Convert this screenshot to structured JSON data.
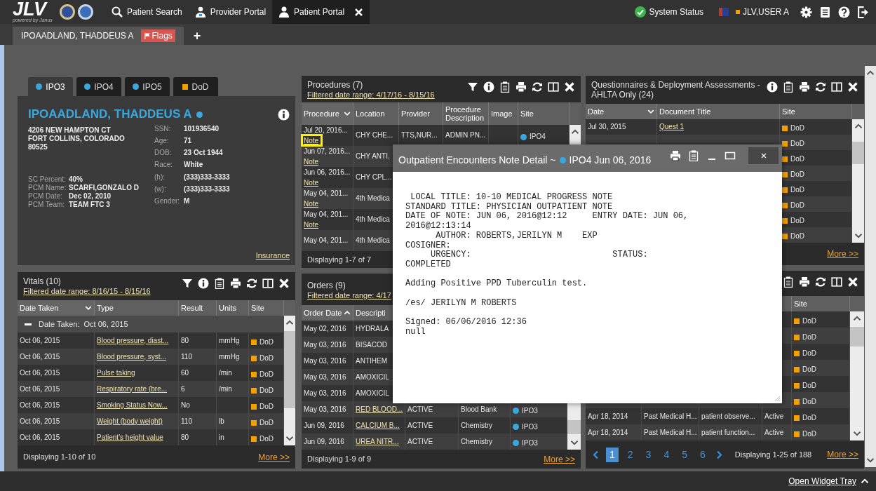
{
  "header": {
    "logo": "JLV",
    "tagline": "powered by Janus",
    "nav": [
      {
        "label": "Patient Search",
        "selected": false,
        "closable": false
      },
      {
        "label": "Provider Portal",
        "selected": false,
        "closable": false
      },
      {
        "label": "Patient Portal",
        "selected": true,
        "closable": true
      }
    ],
    "system_status": "System Status",
    "user": "JLV,USER A"
  },
  "patient_tabs": {
    "tabs": [
      {
        "label": "IPOAADLAND, THADDEUS A",
        "flag": "Flags",
        "selected": true
      }
    ],
    "add": "+"
  },
  "patient_card": {
    "sites": [
      {
        "label": "IPO3",
        "kind": "dot",
        "color": "#3aa8e0",
        "selected": true
      },
      {
        "label": "IPO4",
        "kind": "dot",
        "color": "#3aa8e0",
        "selected": false
      },
      {
        "label": "IPO5",
        "kind": "dot",
        "color": "#3aa8e0",
        "selected": false
      },
      {
        "label": "DoD",
        "kind": "square",
        "color": "#f5a000",
        "selected": false
      }
    ],
    "name": "IPOAADLAND, THADDEUS A",
    "address": [
      "4206 NEW HAMPTON CT",
      "FORT COLLINS, COLORADO",
      "80525"
    ],
    "care_fields": [
      {
        "label": "SC Percent:",
        "value": "40%"
      },
      {
        "label": "PCM Name:",
        "value": "SCARFI,GONZALO D"
      },
      {
        "label": "PCM Date:",
        "value": "Dec 02, 2010"
      },
      {
        "label": "PCM Team:",
        "value": "TEAM FTC 3"
      }
    ],
    "demographics": [
      {
        "label": "SSN:",
        "value": "101936540"
      },
      {
        "label": "Age:",
        "value": "71"
      },
      {
        "label": "DOB:",
        "value": "23 Oct 1944"
      },
      {
        "label": "Race:",
        "value": "White"
      },
      {
        "label": "(h):",
        "value": "(333)333-3333"
      },
      {
        "label": "(w):",
        "value": "(333)333-3333"
      },
      {
        "label": "Gender:",
        "value": "M"
      }
    ],
    "insurance_link": "Insurance"
  },
  "procedures": {
    "title": "Procedures (7)",
    "filter": "Filtered date range: 4/17/16 - 8/15/16",
    "columns": [
      {
        "label": "Procedure",
        "sorted": true,
        "ascending": false
      },
      {
        "label": "Location",
        "sorted": false
      },
      {
        "label": "Provider",
        "sorted": false
      },
      {
        "label": "Procedure Description",
        "sorted": false
      },
      {
        "label": "Image",
        "sorted": false
      },
      {
        "label": "Site",
        "sorted": false
      }
    ],
    "rows": [
      [
        {
          "text": "Jul 20, 2016...",
          "note": "Note"
        },
        "CHY CHE...",
        "TTS,NUR...",
        "ADMIN PN...",
        null,
        {
          "site": "IPO4",
          "kind": "dot",
          "color": "#3aa8e0"
        }
      ],
      [
        {
          "text": "Jun 07, 2016...",
          "note": "Note"
        },
        "CHY ANTI."
      ],
      [
        {
          "text": "Jun 06, 2016...",
          "note": "Note"
        },
        "CHY CPL..."
      ],
      [
        {
          "text": "May 04, 201...",
          "note": "Note"
        },
        "4th Medica"
      ],
      [
        {
          "text": "May 04, 201...",
          "note": "Note"
        },
        "4th Medica"
      ],
      [
        {
          "text": "May 04, 201..."
        },
        "4th Medica"
      ]
    ],
    "footer": "Displaying 1-7 of 7"
  },
  "questionnaires": {
    "title": "Questionnaires & Deployment Assessments - AHLTA Only (24)",
    "columns": [
      {
        "label": "Date",
        "sorted": true,
        "ascending": false
      },
      {
        "label": "Document Title",
        "sorted": false
      },
      {
        "label": "Site",
        "sorted": false
      }
    ],
    "rows": [
      [
        "Jul 30, 2015",
        {
          "link": "Quest 1"
        },
        {
          "site": "DoD",
          "kind": "square",
          "color": "#f5a000"
        }
      ],
      [
        null,
        null,
        {
          "site": "DoD",
          "kind": "square",
          "color": "#f5a000"
        }
      ],
      [
        null,
        null,
        {
          "site": "DoD",
          "kind": "square",
          "color": "#f5a000"
        }
      ],
      [
        null,
        null,
        {
          "site": "DoD",
          "kind": "square",
          "color": "#f5a000"
        }
      ],
      [
        null,
        null,
        {
          "site": "DoD",
          "kind": "square",
          "color": "#f5a000"
        }
      ],
      [
        null,
        null,
        {
          "site": "DoD",
          "kind": "square",
          "color": "#f5a000"
        }
      ],
      [
        null,
        null,
        {
          "site": "DoD",
          "kind": "square",
          "color": "#f5a000"
        }
      ],
      [
        null,
        null,
        {
          "site": "DoD",
          "kind": "square",
          "color": "#f5a000"
        }
      ]
    ],
    "more": "More >>"
  },
  "vitals": {
    "title": "Vitals (10)",
    "filter": "Filtered date range: 8/16/15 - 8/15/16",
    "columns": [
      {
        "label": "Date Taken",
        "sorted": true,
        "ascending": false
      },
      {
        "label": "Type",
        "sorted": false
      },
      {
        "label": "Result",
        "sorted": false
      },
      {
        "label": "Units",
        "sorted": false
      },
      {
        "label": "Site",
        "sorted": false
      }
    ],
    "group": {
      "label": "Date Taken:",
      "value": "Oct 06, 2015",
      "expanded": true
    },
    "rows": [
      [
        "Oct 06, 2015",
        {
          "link": "Blood pressure, diast..."
        },
        "80",
        "mmHg",
        {
          "site": "DoD",
          "kind": "square",
          "color": "#f5a000"
        }
      ],
      [
        "Oct 06, 2015",
        {
          "link": "Blood pressure, syst..."
        },
        "110",
        "mmHg",
        {
          "site": "DoD",
          "kind": "square",
          "color": "#f5a000"
        }
      ],
      [
        "Oct 06, 2015",
        {
          "link": "Pulse taking"
        },
        "60",
        "/min",
        {
          "site": "DoD",
          "kind": "square",
          "color": "#f5a000"
        }
      ],
      [
        "Oct 06, 2015",
        {
          "link": "Respiratory rate (bre..."
        },
        "6",
        "/min",
        {
          "site": "DoD",
          "kind": "square",
          "color": "#f5a000"
        }
      ],
      [
        "Oct 06, 2015",
        {
          "link": "Smoking Status Now..."
        },
        "No",
        null,
        {
          "site": "DoD",
          "kind": "square",
          "color": "#f5a000"
        }
      ],
      [
        "Oct 06, 2015",
        {
          "link": "Weight (body weight)"
        },
        "110",
        "lb",
        {
          "site": "DoD",
          "kind": "square",
          "color": "#f5a000"
        }
      ],
      [
        "Oct 06, 2015",
        {
          "link": "Patient's height value"
        },
        "80",
        "in",
        {
          "site": "DoD",
          "kind": "square",
          "color": "#f5a000"
        }
      ]
    ],
    "footer": "Displaying 1-10 of 10",
    "more": "More >>"
  },
  "orders": {
    "title": "Orders (9)",
    "filter": "Filtered date range: 4/17",
    "columns": [
      {
        "label": "Order Date",
        "sorted": true,
        "ascending": true
      },
      {
        "label": "Descripti"
      },
      null,
      null,
      null
    ],
    "rows": [
      [
        "May 02, 2016",
        "HYDRALA"
      ],
      [
        "May 03, 2016",
        "BISACOD"
      ],
      [
        "May 03, 2016",
        "ANTIHEM"
      ],
      [
        "May 03, 2016",
        "AMOXICIL"
      ],
      [
        "May 03, 2016",
        "AMOXICIL"
      ],
      [
        "May 03, 2016",
        {
          "link": "RED BLOOD..."
        },
        "ACTIVE",
        "Blood Bank",
        {
          "site": "IPO3",
          "kind": "dot",
          "color": "#3aa8e0"
        }
      ],
      [
        "Jun 09, 2016",
        {
          "link": "CALCIUM B..."
        },
        "ACTIVE",
        "Chemistry",
        {
          "site": "IPO3",
          "kind": "dot",
          "color": "#3aa8e0"
        }
      ],
      [
        "Jun 09, 2016",
        {
          "link": "UREA NITR..."
        },
        "ACTIVE",
        "Chemistry",
        {
          "site": "IPO3",
          "kind": "dot",
          "color": "#3aa8e0"
        }
      ]
    ],
    "footer": "Displaying 1-9 of 9",
    "more": "More >>"
  },
  "lower_right_widget": {
    "columns": [
      null,
      null,
      null,
      null,
      {
        "label": "Site",
        "sorted": false
      }
    ],
    "rows": [
      [
        null,
        null,
        null,
        null,
        {
          "site": "DoD",
          "kind": "square",
          "color": "#f5a000"
        }
      ],
      [
        null,
        null,
        null,
        null,
        {
          "site": "DoD",
          "kind": "square",
          "color": "#f5a000"
        }
      ],
      [
        null,
        null,
        null,
        null,
        {
          "site": "DoD",
          "kind": "square",
          "color": "#f5a000"
        }
      ],
      [
        null,
        null,
        null,
        null,
        {
          "site": "DoD",
          "kind": "square",
          "color": "#f5a000"
        }
      ],
      [
        null,
        null,
        null,
        null,
        {
          "site": "DoD",
          "kind": "square",
          "color": "#f5a000"
        }
      ],
      [
        null,
        null,
        null,
        null,
        {
          "site": "DoD",
          "kind": "square",
          "color": "#f5a000"
        }
      ],
      [
        "Apr 18, 2014",
        "Past Medical H...",
        "patient observe...",
        "Active",
        {
          "site": "DoD",
          "kind": "square",
          "color": "#f5a000"
        }
      ],
      [
        "Apr 18, 2014",
        "Past Medical H...",
        "patient function...",
        "Active",
        {
          "site": "DoD",
          "kind": "square",
          "color": "#f5a000"
        }
      ]
    ],
    "pages": [
      {
        "label": "1",
        "selected": true
      },
      {
        "label": "2",
        "selected": false
      },
      {
        "label": "3",
        "selected": false
      },
      {
        "label": "4",
        "selected": false
      },
      {
        "label": "5",
        "selected": false
      },
      {
        "label": "6",
        "selected": false
      }
    ],
    "footer": "Displaying 1-25 of 188",
    "more": "More >>"
  },
  "note_dialog": {
    "title": "Outpatient Encounters Note Detail ~",
    "site": "IPO4 Jun 06, 2016",
    "body": " LOCAL TITLE: 10-10 MEDICAL PROGRESS NOTE\nSTANDARD TITLE: PHYSICIAN OUTPATIENT NOTE\nDATE OF NOTE: JUN 06, 2016@12:12     ENTRY DATE: JUN 06,\n2016@12:13:14\n      AUTHOR: ROBERTS,JERILYN M    EXP\nCOSIGNER:\n     URGENCY:                            STATUS:\nCOMPLETED\n\nAdding Positive PPD Tuberculin test.\n\n/es/ JERILYN M ROBERTS\n\nSigned: 06/06/2016 12:36\nnull"
  },
  "widget_tray_link": "Open Widget Tray"
}
